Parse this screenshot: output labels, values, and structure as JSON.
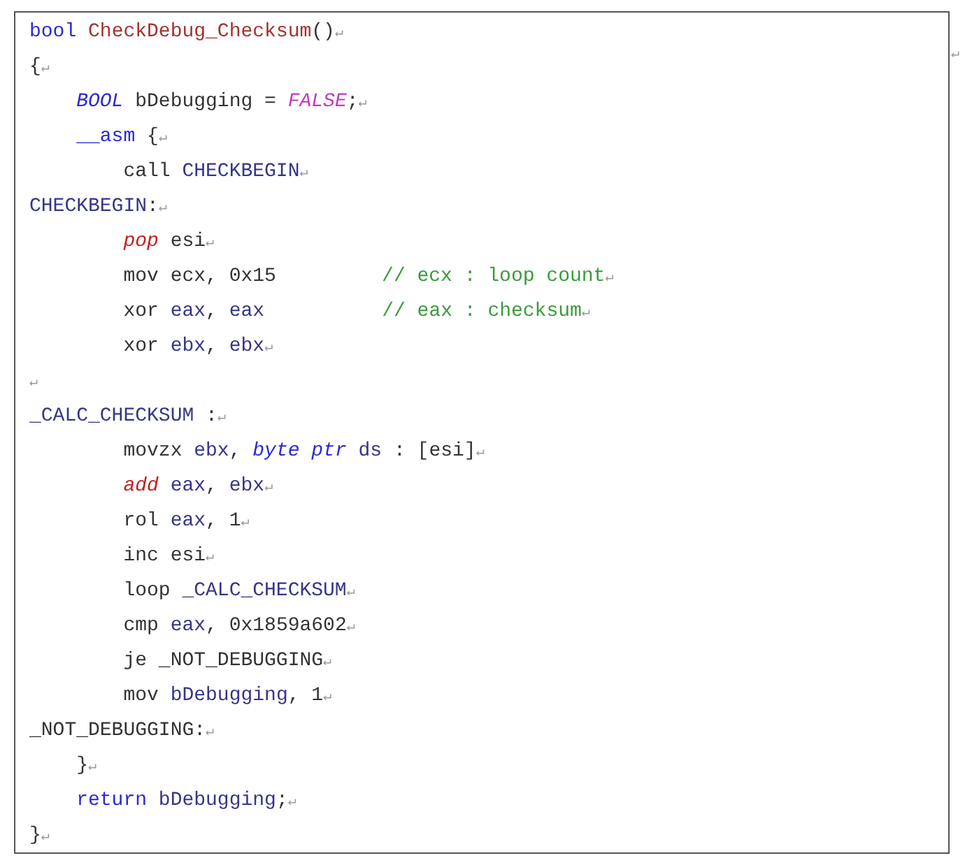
{
  "lines": [
    {
      "segments": [
        {
          "kind": "type",
          "text": "bool "
        },
        {
          "kind": "func",
          "text": "CheckDebug_Checksum"
        },
        {
          "kind": "plain",
          "text": "()"
        },
        {
          "kind": "mark",
          "text": "↵"
        }
      ]
    },
    {
      "segments": [
        {
          "kind": "plain",
          "text": "{"
        },
        {
          "kind": "mark",
          "text": "↵"
        }
      ]
    },
    {
      "segments": [
        {
          "kind": "italic_type",
          "text": "    BOOL"
        },
        {
          "kind": "plain",
          "text": " bDebugging = "
        },
        {
          "kind": "constant",
          "text": "FALSE"
        },
        {
          "kind": "plain",
          "text": ";"
        },
        {
          "kind": "mark",
          "text": "↵"
        }
      ]
    },
    {
      "segments": [
        {
          "kind": "type",
          "text": "    __asm"
        },
        {
          "kind": "plain",
          "text": " {"
        },
        {
          "kind": "mark",
          "text": "↵"
        }
      ]
    },
    {
      "segments": [
        {
          "kind": "plain",
          "text": "        call "
        },
        {
          "kind": "name",
          "text": "CHECKBEGIN"
        },
        {
          "kind": "mark",
          "text": "↵"
        }
      ]
    },
    {
      "segments": [
        {
          "kind": "name",
          "text": "CHECKBEGIN"
        },
        {
          "kind": "plain",
          "text": ":"
        },
        {
          "kind": "mark",
          "text": "↵"
        }
      ]
    },
    {
      "segments": [
        {
          "kind": "opcode",
          "text": "        pop"
        },
        {
          "kind": "plain",
          "text": " esi"
        },
        {
          "kind": "mark",
          "text": "↵"
        }
      ]
    },
    {
      "segments": [
        {
          "kind": "plain",
          "text": "        mov ecx, 0x15         "
        },
        {
          "kind": "comment",
          "text": "// ecx : loop count"
        },
        {
          "kind": "mark",
          "text": "↵"
        }
      ]
    },
    {
      "segments": [
        {
          "kind": "plain",
          "text": "        xor "
        },
        {
          "kind": "name",
          "text": "eax"
        },
        {
          "kind": "plain",
          "text": ", "
        },
        {
          "kind": "name",
          "text": "eax"
        },
        {
          "kind": "comment",
          "text": "          // eax : checksum"
        },
        {
          "kind": "mark",
          "text": "↵"
        }
      ]
    },
    {
      "segments": [
        {
          "kind": "plain",
          "text": "        xor "
        },
        {
          "kind": "name",
          "text": "ebx"
        },
        {
          "kind": "plain",
          "text": ", "
        },
        {
          "kind": "name",
          "text": "ebx"
        },
        {
          "kind": "mark",
          "text": "↵"
        }
      ]
    },
    {
      "segments": [
        {
          "kind": "mark",
          "text": "↵"
        }
      ]
    },
    {
      "segments": [
        {
          "kind": "name",
          "text": "_CALC_CHECKSUM"
        },
        {
          "kind": "plain",
          "text": " :"
        },
        {
          "kind": "mark",
          "text": "↵"
        }
      ]
    },
    {
      "segments": [
        {
          "kind": "plain",
          "text": "        movzx "
        },
        {
          "kind": "name",
          "text": "ebx"
        },
        {
          "kind": "plain",
          "text": ", "
        },
        {
          "kind": "italic_type",
          "text": "byte ptr "
        },
        {
          "kind": "name",
          "text": "ds"
        },
        {
          "kind": "plain",
          "text": " : [esi]"
        },
        {
          "kind": "mark",
          "text": "↵"
        }
      ]
    },
    {
      "segments": [
        {
          "kind": "opcode",
          "text": "        add "
        },
        {
          "kind": "name",
          "text": "eax"
        },
        {
          "kind": "plain",
          "text": ", "
        },
        {
          "kind": "name",
          "text": "ebx"
        },
        {
          "kind": "mark",
          "text": "↵"
        }
      ]
    },
    {
      "segments": [
        {
          "kind": "plain",
          "text": "        rol "
        },
        {
          "kind": "name",
          "text": "eax"
        },
        {
          "kind": "plain",
          "text": ", 1"
        },
        {
          "kind": "mark",
          "text": "↵"
        }
      ]
    },
    {
      "segments": [
        {
          "kind": "plain",
          "text": "        inc esi"
        },
        {
          "kind": "mark",
          "text": "↵"
        }
      ]
    },
    {
      "segments": [
        {
          "kind": "plain",
          "text": "        loop "
        },
        {
          "kind": "name",
          "text": "_CALC_CHECKSUM"
        },
        {
          "kind": "mark",
          "text": "↵"
        }
      ]
    },
    {
      "segments": [
        {
          "kind": "plain",
          "text": "        cmp "
        },
        {
          "kind": "name",
          "text": "eax"
        },
        {
          "kind": "plain",
          "text": ", 0x1859a602"
        },
        {
          "kind": "mark",
          "text": "↵"
        }
      ]
    },
    {
      "segments": [
        {
          "kind": "plain",
          "text": "        je _NOT_DEBUGGING"
        },
        {
          "kind": "mark",
          "text": "↵"
        }
      ]
    },
    {
      "segments": [
        {
          "kind": "plain",
          "text": "        mov "
        },
        {
          "kind": "name",
          "text": "bDebugging"
        },
        {
          "kind": "plain",
          "text": ", 1"
        },
        {
          "kind": "mark",
          "text": "↵"
        }
      ]
    },
    {
      "segments": [
        {
          "kind": "plain",
          "text": "_NOT_DEBUGGING:"
        },
        {
          "kind": "mark",
          "text": "↵"
        }
      ]
    },
    {
      "segments": [
        {
          "kind": "plain",
          "text": "    }"
        },
        {
          "kind": "mark",
          "text": "↵"
        }
      ]
    },
    {
      "segments": [
        {
          "kind": "type",
          "text": "    return "
        },
        {
          "kind": "name",
          "text": "bDebugging"
        },
        {
          "kind": "plain",
          "text": ";"
        },
        {
          "kind": "mark",
          "text": "↵"
        }
      ]
    },
    {
      "segments": [
        {
          "kind": "plain",
          "text": "}"
        },
        {
          "kind": "mark",
          "text": "↵"
        }
      ]
    }
  ],
  "outside_mark": "↵"
}
